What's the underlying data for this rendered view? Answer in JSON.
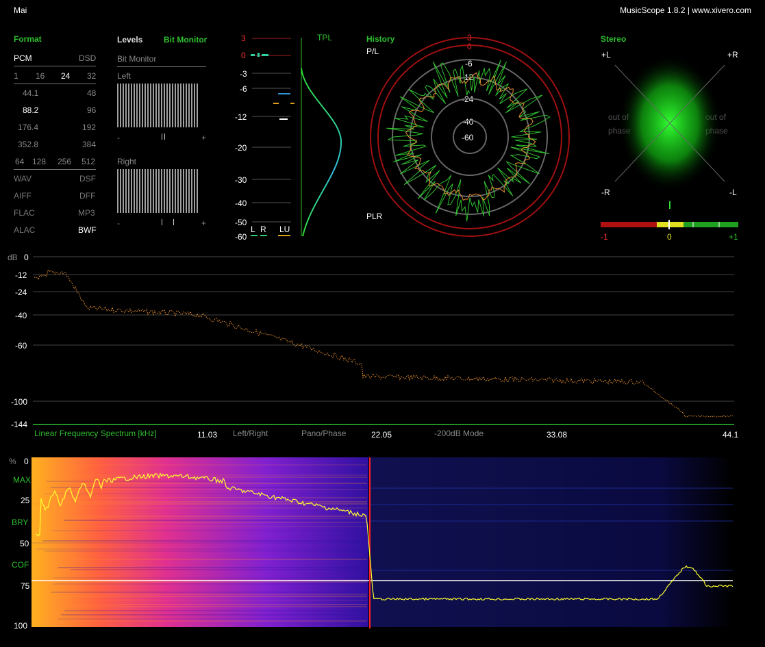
{
  "header": {
    "track": "Mai",
    "app": "MusicScope 1.8.2 | www.xivero.com"
  },
  "format": {
    "title": "Format",
    "pcm": "PCM",
    "dsd": "DSD",
    "bits": [
      "1",
      "16",
      "24",
      "32"
    ],
    "rates": [
      [
        "44.1",
        "48"
      ],
      [
        "88.2",
        "96"
      ],
      [
        "176.4",
        "192"
      ],
      [
        "352.8",
        "384"
      ]
    ],
    "dsd_rates": [
      "64",
      "128",
      "256",
      "512"
    ],
    "containers": [
      [
        "WAV",
        "DSF"
      ],
      [
        "AIFF",
        "DFF"
      ],
      [
        "FLAC",
        "MP3"
      ],
      [
        "ALAC",
        "BWF"
      ]
    ]
  },
  "tabs": {
    "levels": "Levels",
    "bit_monitor": "Bit Monitor"
  },
  "bitmon": {
    "title": "Bit Monitor",
    "left": "Left",
    "right": "Right",
    "minus": "-",
    "plus": "+"
  },
  "levels": {
    "scale": [
      "3",
      "0",
      "-3",
      "-6",
      "-12",
      "-20",
      "-30",
      "-40",
      "-50",
      "-60"
    ],
    "tpl": "TPL",
    "l": "L",
    "r": "R",
    "lu": "LU"
  },
  "history": {
    "title": "History",
    "pl": "P/L",
    "plr": "PLR",
    "rings": [
      "3",
      "0",
      "-6",
      "-12",
      "-24",
      "-40",
      "-60"
    ]
  },
  "stereo": {
    "title": "Stereo",
    "pl": "+L",
    "pr": "+R",
    "mr": "-R",
    "ml": "-L",
    "oop_l1": "out of",
    "oop_l2": "phase",
    "oop_r1": "out of",
    "oop_r2": "phase",
    "corr_min": "-1",
    "corr_mid": "0",
    "corr_max": "+1"
  },
  "spectrum": {
    "db_label": "dB",
    "db_ticks": [
      "0",
      "-12",
      "-24",
      "-40",
      "-60",
      "-100",
      "-144"
    ],
    "title": "Linear Frequency Spectrum [kHz]",
    "khz_ticks": [
      "11.03",
      "22.05",
      "33.08",
      "44.1"
    ],
    "mode_lr": "Left/Right",
    "mode_pano": "Pano/Phase",
    "mode_200": "-200dB Mode"
  },
  "spectrogram": {
    "pct_label": "%",
    "ticks": [
      "0",
      "25",
      "50",
      "75",
      "100"
    ],
    "markers": [
      "MAX",
      "BRY",
      "COF"
    ]
  },
  "colors": {
    "accent_green": "#2fbf2f",
    "peak_red": "#ff2020",
    "curve_orange": "#e89030",
    "curve_yellow": "#ffff30"
  }
}
